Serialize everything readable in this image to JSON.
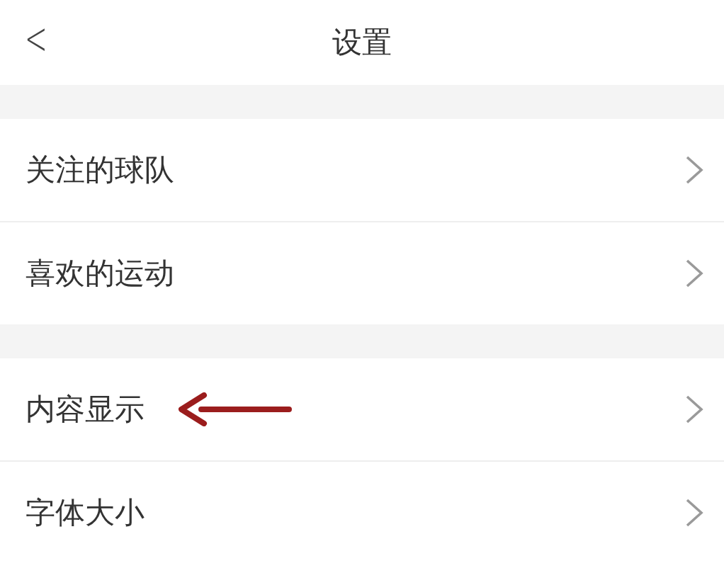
{
  "header": {
    "back": "<",
    "title": "设置"
  },
  "groups": [
    {
      "items": [
        {
          "label": "关注的球队",
          "highlighted": false
        },
        {
          "label": "喜欢的运动",
          "highlighted": false
        }
      ]
    },
    {
      "items": [
        {
          "label": "内容显示",
          "highlighted": true
        },
        {
          "label": "字体大小",
          "highlighted": false
        }
      ]
    }
  ]
}
